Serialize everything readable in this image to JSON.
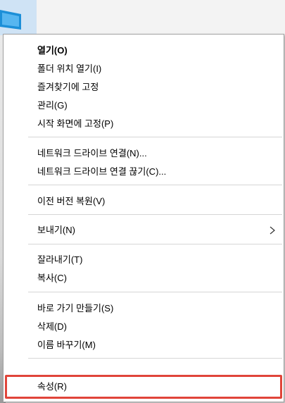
{
  "colors": {
    "highlight": "#e0453a",
    "separator": "#d6d6d6"
  },
  "context_menu": {
    "groups": [
      {
        "items": [
          {
            "label": "열기(O)"
          },
          {
            "label": "폴더 위치 열기(I)"
          },
          {
            "label": "즐겨찾기에 고정"
          },
          {
            "label": "관리(G)"
          },
          {
            "label": "시작 화면에 고정(P)"
          }
        ]
      },
      {
        "items": [
          {
            "label": "네트워크 드라이브 연결(N)..."
          },
          {
            "label": "네트워크 드라이브 연결 끊기(C)..."
          }
        ]
      },
      {
        "items": [
          {
            "label": "이전 버전 복원(V)"
          }
        ]
      },
      {
        "items": [
          {
            "label": "보내기(N)",
            "submenu_icon": "chevron-right-icon"
          }
        ]
      },
      {
        "items": [
          {
            "label": "잘라내기(T)"
          },
          {
            "label": "복사(C)"
          }
        ]
      },
      {
        "items": [
          {
            "label": "바로 가기 만들기(S)"
          },
          {
            "label": "삭제(D)"
          },
          {
            "label": "이름 바꾸기(M)"
          }
        ]
      },
      {
        "items": [
          {
            "label": "속성(R)",
            "highlighted": true
          }
        ]
      }
    ]
  }
}
